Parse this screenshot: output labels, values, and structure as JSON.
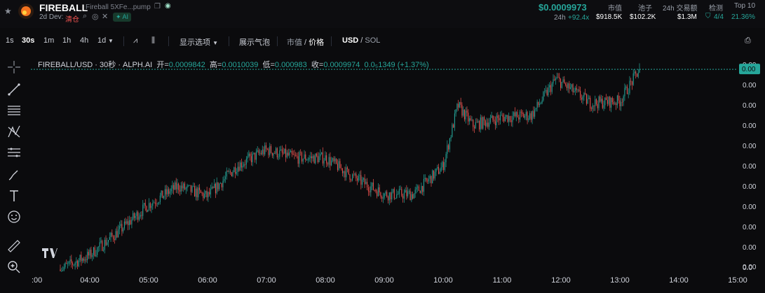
{
  "header": {
    "symbol": "FIREBALL",
    "subtitle": "Fireball 5XFe...pump",
    "dev": "2d Dev:",
    "dev_status": "清仓",
    "ai_badge": "AI",
    "price": "$0.0009973",
    "change_label": "24h",
    "change_value": "+92.4x",
    "stats": [
      {
        "label": "市值",
        "value": "$918.5K"
      },
      {
        "label": "池子",
        "value": "$102.2K"
      },
      {
        "label": "24h 交易额",
        "value": "$1.3M"
      },
      {
        "label": "检测",
        "value": "4/4"
      },
      {
        "label": "Top 10",
        "value": "21.36%"
      }
    ]
  },
  "toolbar": {
    "intervals": [
      "1s",
      "30s",
      "1m",
      "1h",
      "4h",
      "1d"
    ],
    "selected_interval": "30s",
    "display_options": "显示选项",
    "show_bubbles": "展示气泡",
    "mcap_price_a": "市值",
    "mcap_price_b": "价格",
    "currency_a": "USD",
    "currency_b": "SOL"
  },
  "legend": {
    "title": "FIREBALL/USD · 30秒 · ALPH.AI",
    "open_label": "开=",
    "open": "0.0009842",
    "high_label": "高=",
    "high": "0.0010039",
    "low_label": "低=",
    "low": "0.000983",
    "close_label": "收=",
    "close": "0.0009974",
    "change": "0.0₅1349 (+1.37%)"
  },
  "colors": {
    "up": "#26a69a",
    "down": "#ef5350",
    "background": "#0b0b0d",
    "price_line": "#26a69a",
    "logo": "#f5731f"
  },
  "chart_data": {
    "type": "candlestick",
    "xlabel": "",
    "ylabel": "",
    "x_ticks": [
      ":00",
      "04:00",
      "05:00",
      "06:00",
      "07:00",
      "08:00",
      "09:00",
      "10:00",
      "11:00",
      "12:00",
      "13:00",
      "14:00",
      "15:00"
    ],
    "y_ticks": [
      "0.00",
      "0.00",
      "0.00",
      "0.00",
      "0.00",
      "0.00",
      "0.00",
      "0.00",
      "0.00",
      "0.00",
      "0.00",
      "0.0"
    ],
    "current_price_label": "0.00",
    "x_range": [
      "03:00",
      "15:00"
    ],
    "y_range": [
      0,
      0.00107
    ],
    "grid": false,
    "legend_position": "top-left",
    "interval": "30s",
    "trend": [
      {
        "time": "03:30",
        "price": 1e-05
      },
      {
        "time": "04:00",
        "price": 8e-05
      },
      {
        "time": "04:30",
        "price": 0.0002
      },
      {
        "time": "05:00",
        "price": 0.00033
      },
      {
        "time": "05:30",
        "price": 0.00042
      },
      {
        "time": "06:00",
        "price": 0.00037
      },
      {
        "time": "06:30",
        "price": 0.00052
      },
      {
        "time": "07:00",
        "price": 0.0006
      },
      {
        "time": "07:30",
        "price": 0.00056
      },
      {
        "time": "08:00",
        "price": 0.00056
      },
      {
        "time": "08:30",
        "price": 0.00046
      },
      {
        "time": "09:00",
        "price": 0.00038
      },
      {
        "time": "09:30",
        "price": 0.00038
      },
      {
        "time": "10:00",
        "price": 0.00052
      },
      {
        "time": "10:15",
        "price": 0.00082
      },
      {
        "time": "10:30",
        "price": 0.00072
      },
      {
        "time": "11:00",
        "price": 0.00076
      },
      {
        "time": "11:30",
        "price": 0.00077
      },
      {
        "time": "11:55",
        "price": 0.00095
      },
      {
        "time": "12:30",
        "price": 0.00083
      },
      {
        "time": "13:00",
        "price": 0.00084
      },
      {
        "time": "13:20",
        "price": 0.000997
      }
    ]
  }
}
